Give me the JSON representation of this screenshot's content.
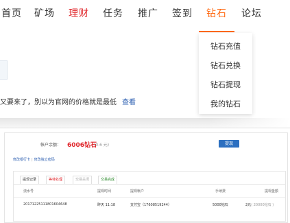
{
  "nav": {
    "items": [
      {
        "label": "首页"
      },
      {
        "label": "矿场"
      },
      {
        "label": "理财"
      },
      {
        "label": "任务"
      },
      {
        "label": "推广"
      },
      {
        "label": "签到"
      },
      {
        "label": "钻石"
      },
      {
        "label": "论坛"
      }
    ],
    "active": "钻石",
    "colors": {
      "highlight": "#e0262b",
      "active": "#ff6a13"
    }
  },
  "dropdown": {
    "items": [
      {
        "label": "钻石充值"
      },
      {
        "label": "钻石兑换"
      },
      {
        "label": "钻石提现"
      },
      {
        "label": "我的钻石"
      }
    ]
  },
  "notice": {
    "text": "又要来了，别以为官网的价格就是最低",
    "link": "查看"
  },
  "account": {
    "balance_label": "帐户余额：",
    "balance_value": "6006钻石",
    "balance_sub": "(0.6 元)",
    "withdraw_button": "提现",
    "links": {
      "bank": "修改银行卡",
      "sep": "|",
      "password": "修改独立密码"
    }
  },
  "records": {
    "tabs": [
      {
        "label": "提现记录"
      },
      {
        "label": "等待处理"
      },
      {
        "label": "交易关闭"
      },
      {
        "label": "交易完成"
      }
    ],
    "columns": [
      "流水号",
      "提现时间",
      "提现帐户",
      "手续费",
      "提现金额"
    ],
    "rows": [
      {
        "serial": "20171225111801604648",
        "time": "昨天 11:18",
        "account": "支付宝（17608519244）",
        "fee": "5000钻石",
        "amount": "2元",
        "amount_detail": "( 20000钻石 )"
      }
    ]
  }
}
